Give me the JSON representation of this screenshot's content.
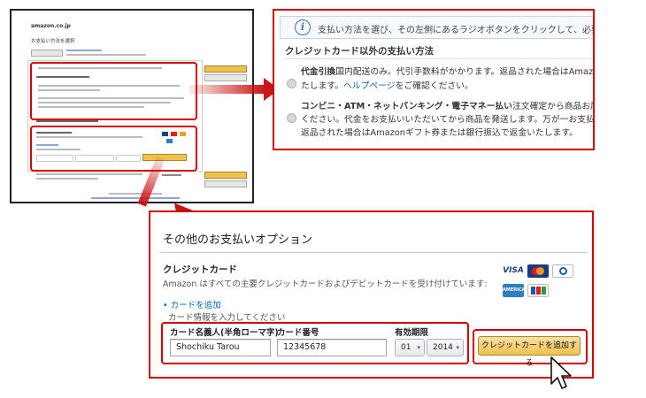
{
  "thumbnail": {
    "logo": "amazon.co.jp",
    "heading": "お支払い方法を選択"
  },
  "info_bar": {
    "text": "支払い方法を選び、その左側にあるラジオボタンをクリックして、必要な情"
  },
  "other_methods": {
    "title": "クレジットカード以外の支払い方法",
    "option1": {
      "name": "代金引換",
      "line1": "国内配送のみ。代引手数料がかかります。返品された場合はAmazonギフト",
      "line2_pre": "たします。",
      "line2_link": "ヘルプページ",
      "line2_post": "をご確認ください。"
    },
    "option2": {
      "name": "コンビニ・ATM・ネットバンキング・電子マネー払い",
      "line1_rest": "注文確定から商品お届けまでの流",
      "line2": "ください。代金をお支払いいただいてから商品を発送します。万が一お支払い後に注文",
      "line3": "返品された場合はAmazonギフト券または銀行振込で返金いたします。"
    }
  },
  "payment_options": {
    "title": "その他のお支払いオプション",
    "credit_card_title": "クレジットカード",
    "credit_card_desc": "Amazon はすべての主要クレジットカードおよびデビットカードを受け付けています:",
    "add_card_link": "カードを追加",
    "enter_info": "カード情報を入力してください",
    "cardholder_label": "カード名義人(半角ローマ字)",
    "cardholder_value": "Shochiku Tarou",
    "card_number_label": "カード番号",
    "card_number_value": "12345678",
    "expiry_label": "有効期限",
    "expiry_month": "01",
    "expiry_year": "2014",
    "add_button": "クレジットカードを追加する"
  },
  "card_brands": {
    "visa": "VISA",
    "amex": "AMERICAN EXPRESS"
  },
  "colors": {
    "highlight_red": "#d40000",
    "link_blue": "#0066c0",
    "button_gold": "#f0c14b"
  }
}
